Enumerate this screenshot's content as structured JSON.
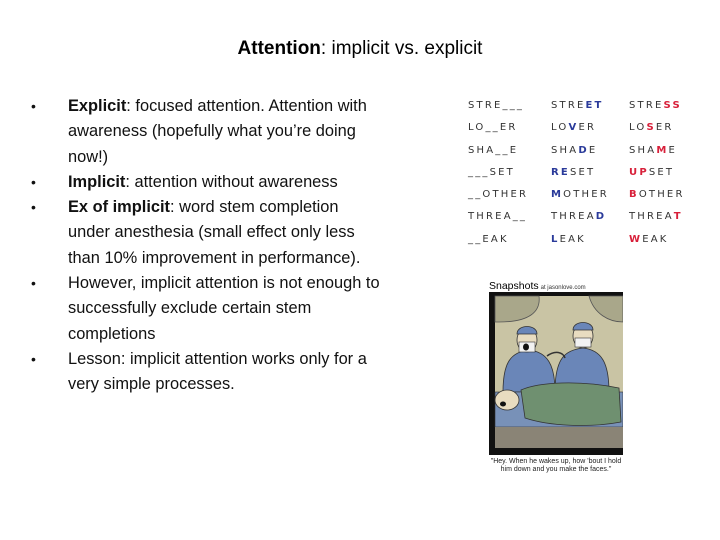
{
  "title": {
    "bold": "Attention",
    "rest": ": implicit vs. explicit"
  },
  "bullets": [
    {
      "bold": "Explicit",
      "text": ": focused attention. Attention with awareness (hopefully what you’re doing now!)"
    },
    {
      "bold": "Implicit",
      "text": ": attention without awareness"
    },
    {
      "bold": "Ex of implicit",
      "text": ": word stem completion under anesthesia (small effect only less than 10% improvement in performance)."
    },
    {
      "bold": "",
      "text": "However, implicit attention is not enough to successfully exclude certain stem completions"
    },
    {
      "bold": "",
      "text": "Lesson: implicit attention works only for a very simple processes."
    }
  ],
  "bullet_glyph": "•",
  "word_table": {
    "colors": {
      "blue": "#2a3a9a",
      "red": "#d8203a"
    },
    "rows": [
      {
        "stem": "STRE___",
        "blue": [
          [
            "STRE",
            ""
          ],
          [
            "ET",
            "b"
          ]
        ],
        "red": [
          [
            "STRE",
            ""
          ],
          [
            "SS",
            "r"
          ]
        ]
      },
      {
        "stem": "LO__ER",
        "blue": [
          [
            "LO",
            ""
          ],
          [
            "V",
            "b"
          ],
          [
            "ER",
            ""
          ]
        ],
        "red": [
          [
            "LO",
            ""
          ],
          [
            "S",
            "r"
          ],
          [
            "ER",
            ""
          ]
        ]
      },
      {
        "stem": "SHA__E",
        "blue": [
          [
            "SHA",
            ""
          ],
          [
            "D",
            "b"
          ],
          [
            "E",
            ""
          ]
        ],
        "red": [
          [
            "SHA",
            ""
          ],
          [
            "M",
            "r"
          ],
          [
            "E",
            ""
          ]
        ]
      },
      {
        "stem": "___SET",
        "blue": [
          [
            "RE",
            "b"
          ],
          [
            "SET",
            ""
          ]
        ],
        "red": [
          [
            "UP",
            "r"
          ],
          [
            "SET",
            ""
          ]
        ]
      },
      {
        "stem": "__OTHER",
        "blue": [
          [
            "M",
            "b"
          ],
          [
            "OTHER",
            ""
          ]
        ],
        "red": [
          [
            "B",
            "r"
          ],
          [
            "OTHER",
            ""
          ]
        ]
      },
      {
        "stem": "THREA__",
        "blue": [
          [
            "THREA",
            ""
          ],
          [
            "D",
            "b"
          ]
        ],
        "red": [
          [
            "THREA",
            ""
          ],
          [
            "T",
            "r"
          ]
        ]
      },
      {
        "stem": "__EAK",
        "blue": [
          [
            "L",
            "b"
          ],
          [
            "EAK",
            ""
          ]
        ],
        "red": [
          [
            "W",
            "r"
          ],
          [
            "EAK",
            ""
          ]
        ]
      }
    ]
  },
  "cartoon": {
    "header": "Snapshots",
    "header_small": "at jasonlove.com",
    "caption": "\"Hey. When he wakes up, how 'bout I hold him down and you make the faces.\""
  }
}
